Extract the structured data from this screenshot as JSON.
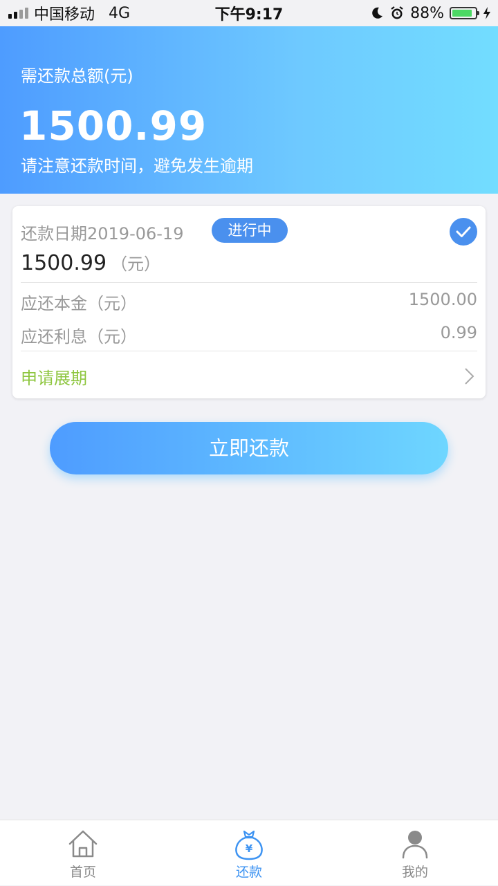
{
  "status_bar": {
    "carrier": "中国移动",
    "network": "4G",
    "time": "下午9:17",
    "battery_percent": "88%",
    "battery_level": 0.88,
    "icons": [
      "signal-icon",
      "moon-icon",
      "alarm-icon",
      "battery-icon",
      "charging-icon"
    ]
  },
  "header": {
    "label": "需还款总额(元)",
    "amount": "1500.99",
    "note": "请注意还款时间，避免发生逾期"
  },
  "card": {
    "date_label": "还款日期2019-06-19",
    "status_badge": "进行中",
    "amount": "1500.99",
    "amount_unit": "（元）",
    "rows": [
      {
        "label": "应还本金（元）",
        "value": "1500.00"
      },
      {
        "label": "应还利息（元）",
        "value": "0.99"
      }
    ],
    "extend_label": "申请展期"
  },
  "actions": {
    "repay_label": "立即还款"
  },
  "tabs": [
    {
      "label": "首页",
      "icon": "home-icon",
      "active": false
    },
    {
      "label": "还款",
      "icon": "money-bag-icon",
      "active": true
    },
    {
      "label": "我的",
      "icon": "user-icon",
      "active": false
    }
  ],
  "colors": {
    "accent": "#4a90ee",
    "gradient_start": "#4e9cff",
    "gradient_end": "#72ddff",
    "extend_green": "#8ec63f",
    "battery_green": "#4cd964"
  }
}
